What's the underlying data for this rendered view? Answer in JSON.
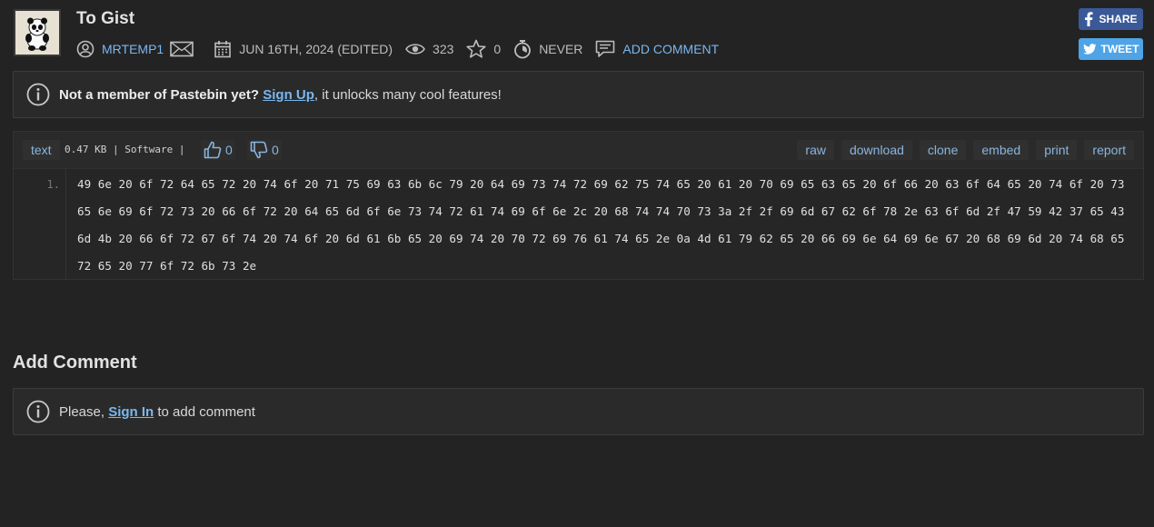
{
  "paste": {
    "title": "To Gist",
    "author": "MRTEMP1",
    "date": "JUN 16TH, 2024 (EDITED)",
    "views": "323",
    "stars": "0",
    "expiry": "NEVER",
    "add_comment_label": "ADD COMMENT"
  },
  "social": {
    "share_label": "SHARE",
    "tweet_label": "TWEET"
  },
  "signup_notice": {
    "bold_text": "Not a member of Pastebin yet?",
    "link_text": "Sign Up",
    "rest_text": ", it unlocks many cool features!"
  },
  "toolbar": {
    "syntax": "text",
    "size_category": "0.47 KB | Software |",
    "likes": "0",
    "dislikes": "0",
    "actions": [
      "raw",
      "download",
      "clone",
      "embed",
      "print",
      "report"
    ]
  },
  "code": {
    "line_numbers": [
      "1."
    ],
    "content": "49 6e 20 6f 72 64 65 72 20 74 6f 20 71 75 69 63 6b 6c 79 20 64 69 73 74 72 69 62 75 74 65 20 61 20 70 69 65 63 65 20 6f 66 20 63 6f 64 65 20 74 6f 20 73 65 6e 69 6f 72 73 20 66 6f 72 20 64 65 6d 6f 6e 73 74 72 61 74 69 6f 6e 2c 20 68 74 74 70 73 3a 2f 2f 69 6d 67 62 6f 78 2e 63 6f 6d 2f 47 59 42 37 65 43 6d 4b 20 66 6f 72 67 6f 74 20 74 6f 20 6d 61 6b 65 20 69 74 20 70 72 69 76 61 74 65 2e 0a 4d 61 79 62 65 20 66 69 6e 64 69 6e 67 20 68 69 6d 20 74 68 65 72 65 20 77 6f 72 6b 73 2e"
  },
  "comments": {
    "heading": "Add Comment",
    "prefix": "Please, ",
    "link_text": "Sign In",
    "suffix": " to add comment"
  },
  "colors": {
    "background": "#232323",
    "link": "#7ab7ef",
    "facebook": "#3b5998",
    "twitter": "#4ea4e6"
  }
}
